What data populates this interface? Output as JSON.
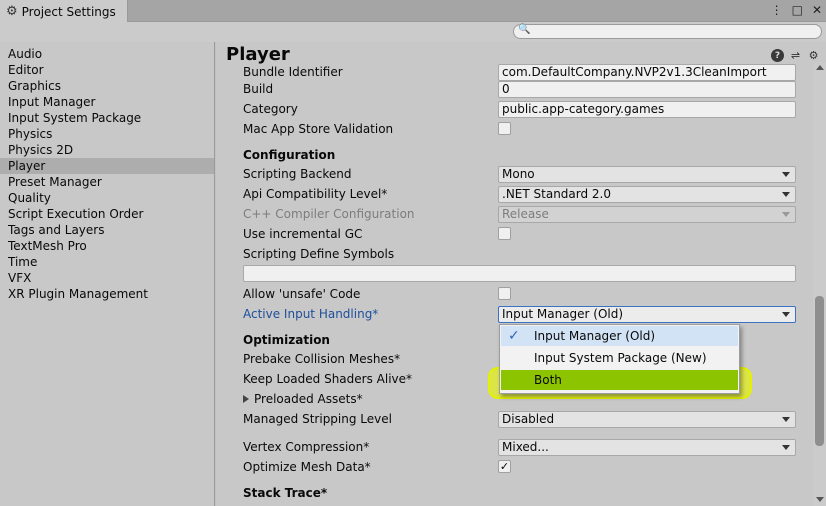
{
  "window": {
    "tab_title": "Project Settings",
    "menu_icon": "kebab-menu-icon",
    "maximize_icon": "maximize-icon",
    "close_icon": "close-icon"
  },
  "search": {
    "placeholder": "",
    "value": ""
  },
  "sidebar": {
    "items": [
      {
        "label": "Audio"
      },
      {
        "label": "Editor"
      },
      {
        "label": "Graphics"
      },
      {
        "label": "Input Manager"
      },
      {
        "label": "Input System Package"
      },
      {
        "label": "Physics"
      },
      {
        "label": "Physics 2D"
      },
      {
        "label": "Player"
      },
      {
        "label": "Preset Manager"
      },
      {
        "label": "Quality"
      },
      {
        "label": "Script Execution Order"
      },
      {
        "label": "Tags and Layers"
      },
      {
        "label": "TextMesh Pro"
      },
      {
        "label": "Time"
      },
      {
        "label": "VFX"
      },
      {
        "label": "XR Plugin Management"
      }
    ],
    "selected": "Player"
  },
  "main": {
    "title": "Player",
    "rows": {
      "bundle_identifier": {
        "label": "Bundle Identifier",
        "value": "com.DefaultCompany.NVP2v1.3CleanImport"
      },
      "build": {
        "label": "Build",
        "value": "0"
      },
      "category": {
        "label": "Category",
        "value": "public.app-category.games"
      },
      "mac_app_store_validation": {
        "label": "Mac App Store Validation"
      },
      "configuration": {
        "label": "Configuration"
      },
      "scripting_backend": {
        "label": "Scripting Backend",
        "value": "Mono"
      },
      "api_compatibility": {
        "label": "Api Compatibility Level*",
        "value": ".NET Standard 2.0"
      },
      "cpp_compiler": {
        "label": "C++ Compiler Configuration",
        "value": "Release"
      },
      "incremental_gc": {
        "label": "Use incremental GC"
      },
      "define_symbols": {
        "label": "Scripting Define Symbols"
      },
      "allow_unsafe": {
        "label": "Allow 'unsafe' Code"
      },
      "active_input": {
        "label": "Active Input Handling*",
        "value": "Input Manager (Old)"
      },
      "optimization": {
        "label": "Optimization"
      },
      "prebake": {
        "label": "Prebake Collision Meshes*"
      },
      "keep_shaders": {
        "label": "Keep Loaded Shaders Alive*"
      },
      "preloaded_assets": {
        "label": "Preloaded Assets*"
      },
      "managed_stripping": {
        "label": "Managed Stripping Level",
        "value": "Disabled"
      },
      "vertex_compression": {
        "label": "Vertex Compression*",
        "value": "Mixed..."
      },
      "optimize_mesh": {
        "label": "Optimize Mesh Data*",
        "check": "✓"
      },
      "stack_trace": {
        "label": "Stack Trace*"
      }
    },
    "popup": {
      "options": [
        {
          "label": "Input Manager (Old)",
          "check": "✓"
        },
        {
          "label": "Input System Package (New)"
        },
        {
          "label": "Both"
        }
      ]
    },
    "colors": {
      "highlight": "#e6f500",
      "both_option": "#8dc400",
      "link_label": "#1d4f9b"
    }
  }
}
